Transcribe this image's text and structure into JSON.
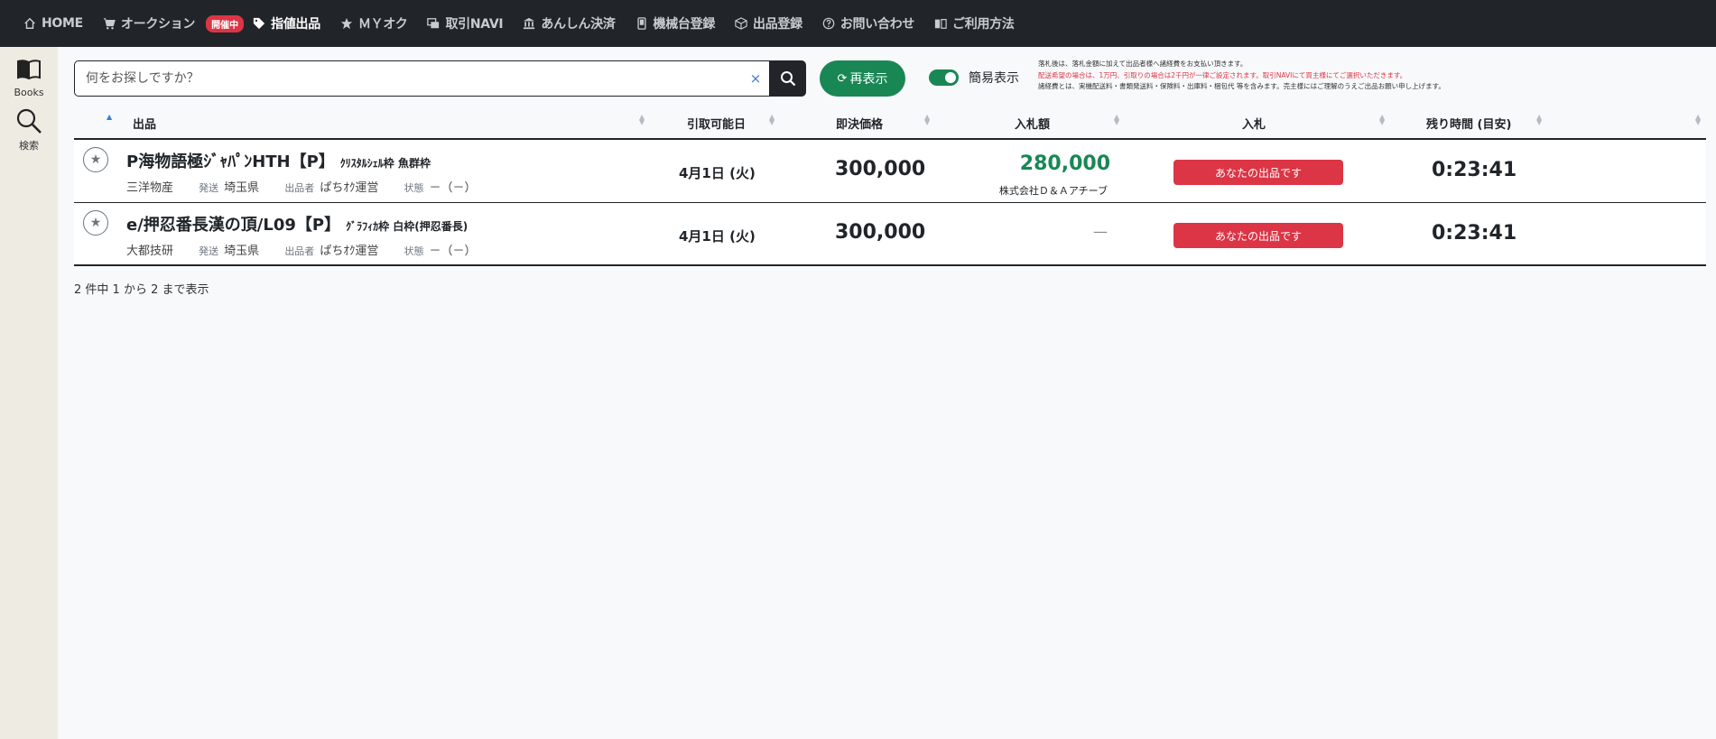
{
  "nav": {
    "items": [
      {
        "label": "HOME",
        "icon": "home-icon",
        "active": false
      },
      {
        "label": "オークション",
        "icon": "cart-icon",
        "active": false
      },
      {
        "label": "指値出品",
        "icon": "tag-icon",
        "active": true
      },
      {
        "label": "ＭＹオク",
        "icon": "star-icon",
        "active": false
      },
      {
        "label": "取引NAVI",
        "icon": "windows-icon",
        "active": false
      },
      {
        "label": "あんしん決済",
        "icon": "bank-icon",
        "active": false
      },
      {
        "label": "機械台登録",
        "icon": "phone-icon",
        "active": false
      },
      {
        "label": "出品登録",
        "icon": "box-icon",
        "active": false
      },
      {
        "label": "お問い合わせ",
        "icon": "question-icon",
        "active": false
      },
      {
        "label": "ご利用方法",
        "icon": "book-icon",
        "active": false
      }
    ],
    "live_badge": "開催中"
  },
  "sidebar": {
    "books_label": "Books",
    "search_label": "検索"
  },
  "toolbar": {
    "search_placeholder": "何をお探しですか？",
    "clear_label": "×",
    "refresh_label": "再表示",
    "simple_view_label": "簡易表示"
  },
  "notes": {
    "line1": "落札後は、落札金額に加えて出品者様へ諸経費をお支払い頂きます。",
    "line2": "配送希望の場合は、1万円、引取りの場合は2千円が一律ご設定されます。取引NAVIにて買主様にてご選択いただきます。",
    "line3": "諸経費とは、実機配送料・書類発送料・保険料・出庫料・梱包代 等を含みます。売主様にはご理解のうえご出品お願い申し上げます。"
  },
  "table": {
    "headers": {
      "item": "出品",
      "pickup_date": "引取可能日",
      "buy_now": "即決価格",
      "bid_amount": "入札額",
      "bid": "入札",
      "time_left": "残り時間 (目安)"
    },
    "rows": [
      {
        "title": "P海物語極ｼﾞｬﾊﾟﾝHTH【P】",
        "subtitle": "ｸﾘｽﾀﾙｼｪﾙ枠 魚群枠",
        "maker": "三洋物産",
        "ship_label": "発送",
        "ship_value": "埼玉県",
        "seller_label": "出品者",
        "seller_value": "ぱちｵｸ運営",
        "condition_label": "状態",
        "condition_value": "－（－）",
        "date": "4月1日 (火)",
        "price": "300,000",
        "bid": "280,000",
        "bidder": "株式会社Ｄ＆Ａアチーブ",
        "status": "あなたの出品です",
        "time": "0:23:41"
      },
      {
        "title": "e/押忍番長漢の頂/L09【P】",
        "subtitle": "ｸﾞﾗﾌｨｶ枠 白枠(押忍番長)",
        "maker": "大都技研",
        "ship_label": "発送",
        "ship_value": "埼玉県",
        "seller_label": "出品者",
        "seller_value": "ぱちｵｸ運営",
        "condition_label": "状態",
        "condition_value": "－（－）",
        "date": "4月1日 (火)",
        "price": "300,000",
        "bid": "—",
        "bidder": "",
        "status": "あなたの出品です",
        "time": "0:23:41"
      }
    ],
    "info": "2 件中 1 から 2 まで表示"
  },
  "colors": {
    "nav_bg": "#212529",
    "accent_green": "#198754",
    "danger_red": "#dc3545",
    "sidebar_bg": "#eeebe3"
  }
}
